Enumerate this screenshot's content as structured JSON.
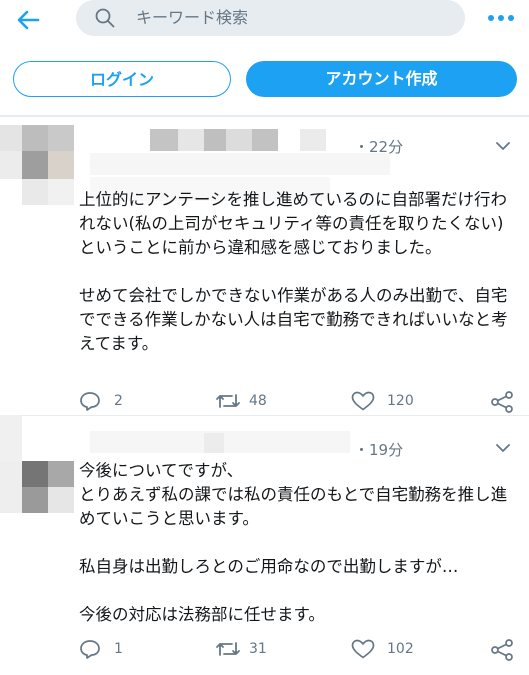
{
  "header": {
    "search_placeholder": "キーワード検索"
  },
  "auth": {
    "login_label": "ログイン",
    "signup_label": "アカウント作成"
  },
  "tweets": [
    {
      "time": "・22分",
      "text": "上位的にアンテーシを推し進めているのに自部署だけ行われない(私の上司がセキュリティ等の責任を取りたくない)ということに前から違和感を感じておりました。\n\nせめて会社でしかできない作業がある人のみ出勤で、自宅でできる作業しかない人は自宅で勤務できればいいなと考えてます。",
      "reply_count": "2",
      "retweet_count": "48",
      "like_count": "120"
    },
    {
      "time": "・19分",
      "text": "今後についてですが、\nとりあえず私の課では私の責任のもとで自宅勤務を推し進めていこうと思います。\n\n私自身は出勤しろとのご用命なので出勤しますが…\n\n今後の対応は法務部に任せます。",
      "reply_count": "1",
      "retweet_count": "31",
      "like_count": "102"
    }
  ],
  "colors": {
    "accent": "#1da1f2",
    "secondary_text": "#657786",
    "primary_text": "#14171a",
    "divider": "#e6ecf0"
  },
  "icons": [
    "back-arrow-icon",
    "search-icon",
    "more-icon",
    "caret-down-icon",
    "reply-icon",
    "retweet-icon",
    "like-icon",
    "share-icon"
  ]
}
